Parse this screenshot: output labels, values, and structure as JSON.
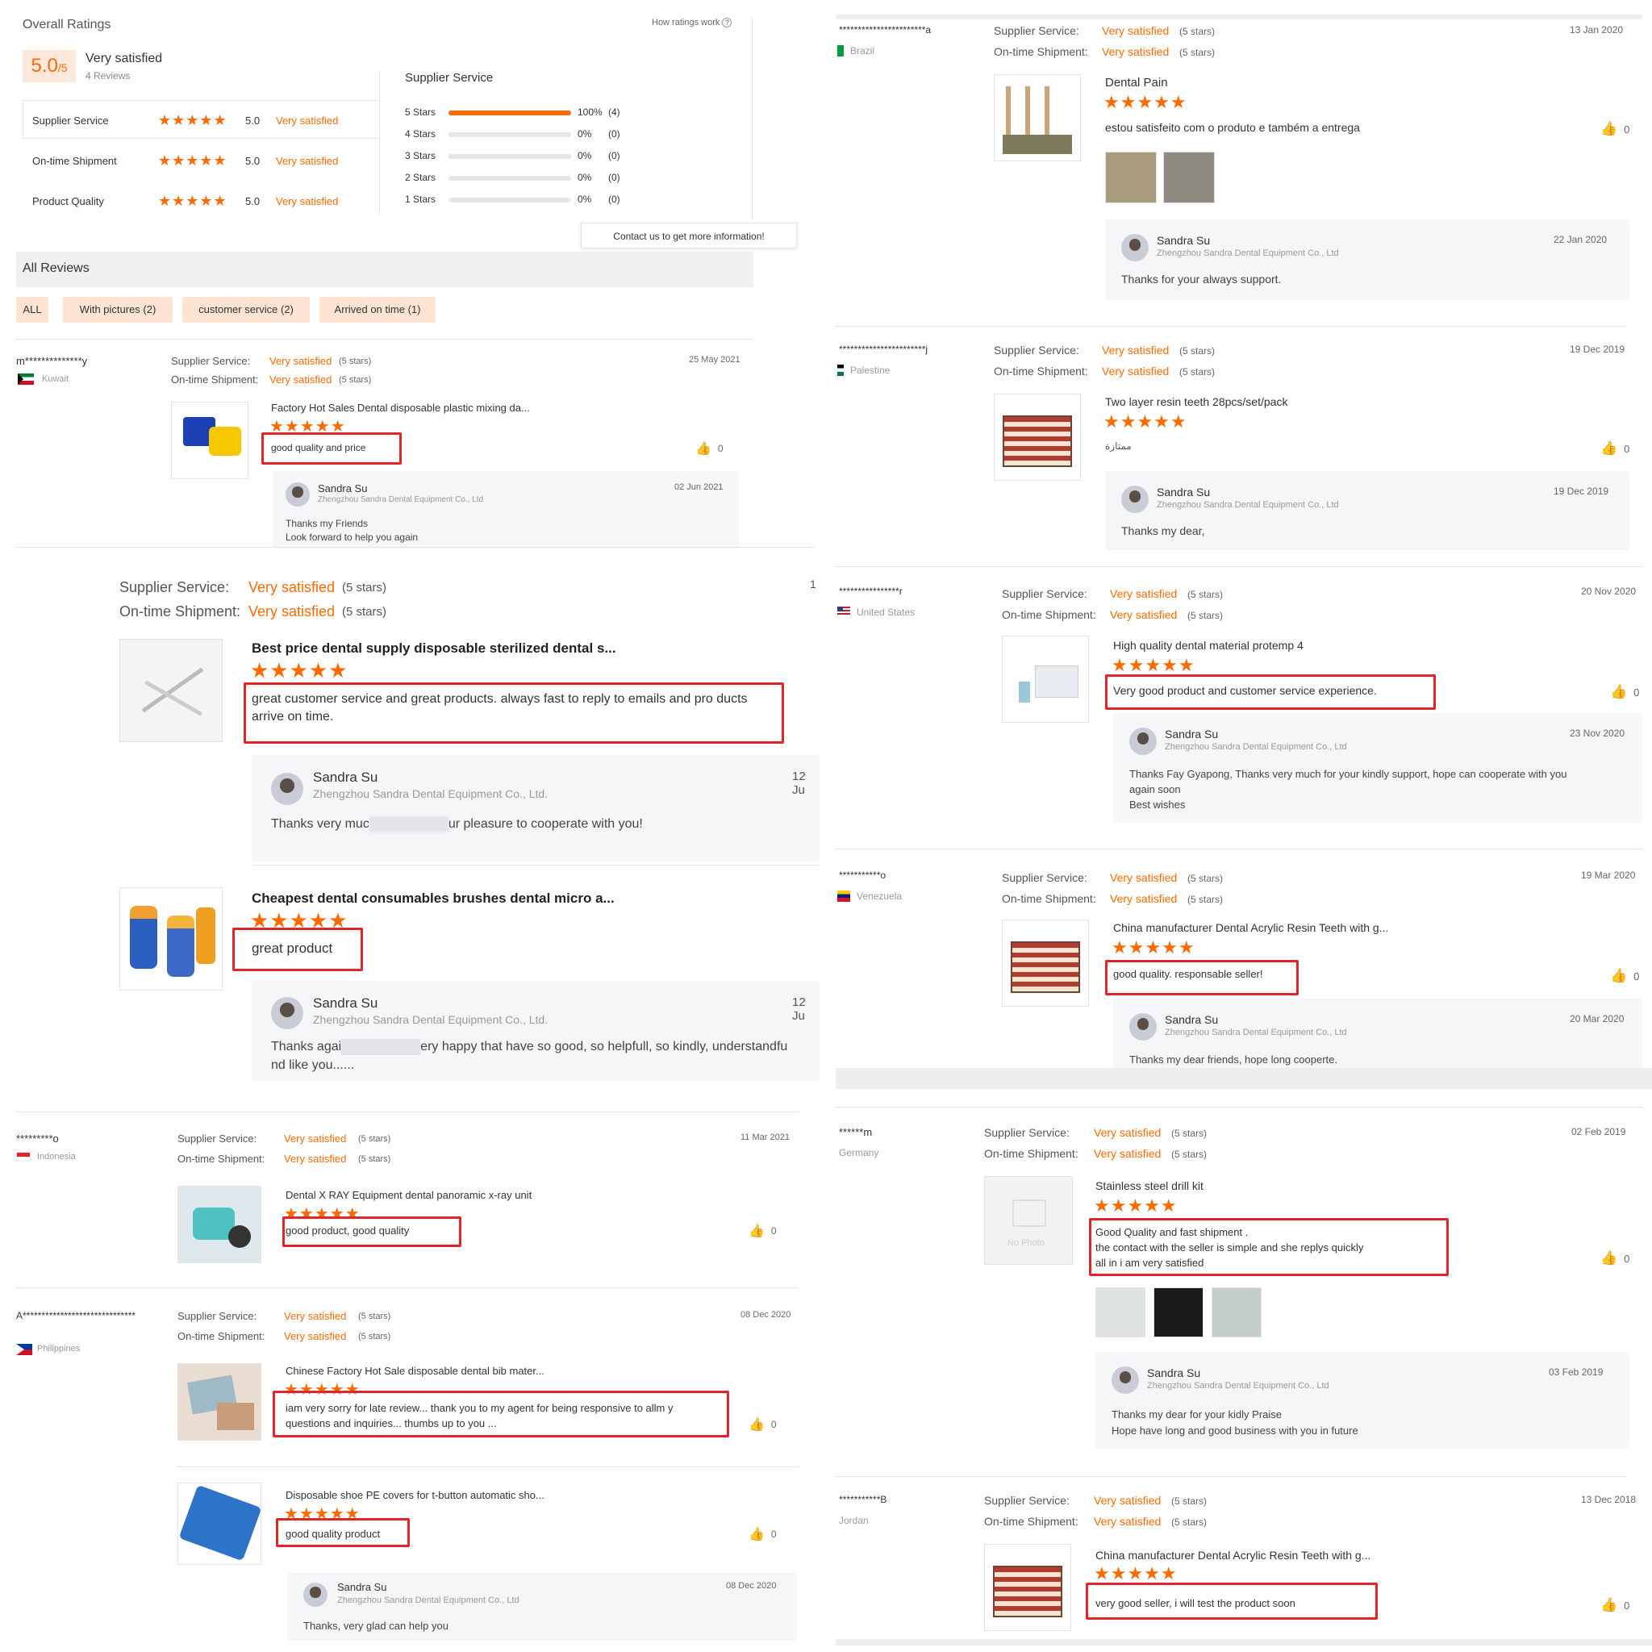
{
  "overall": {
    "title": "Overall Ratings",
    "how_link": "How ratings work",
    "score": "5.0",
    "score_suffix": "/5",
    "satisfaction": "Very satisfied",
    "reviews_count": "4 Reviews",
    "rows": [
      {
        "label": "Supplier Service",
        "stars": "★★★★★",
        "value": "5.0",
        "text": "Very satisfied"
      },
      {
        "label": "On-time Shipment",
        "stars": "★★★★★",
        "value": "5.0",
        "text": "Very satisfied"
      },
      {
        "label": "Product Quality",
        "stars": "★★★★★",
        "value": "5.0",
        "text": "Very satisfied"
      }
    ],
    "breakdown_title": "Supplier Service",
    "breakdown": [
      {
        "label": "5 Stars",
        "percent": "100%",
        "count": "(4)",
        "fill": 1.0
      },
      {
        "label": "4 Stars",
        "percent": "0%",
        "count": "(0)",
        "fill": 0
      },
      {
        "label": "3 Stars",
        "percent": "0%",
        "count": "(0)",
        "fill": 0
      },
      {
        "label": "2 Stars",
        "percent": "0%",
        "count": "(0)",
        "fill": 0
      },
      {
        "label": "1 Stars",
        "percent": "0%",
        "count": "(0)",
        "fill": 0
      }
    ],
    "contact": "Contact us to get more information!"
  },
  "all_reviews": {
    "title": "All Reviews",
    "filters": [
      "ALL",
      "With pictures (2)",
      "customer service (2)",
      "Arrived on time (1)"
    ]
  },
  "labels": {
    "supplier_service": "Supplier Service:",
    "ontime_shipment": "On-time Shipment:",
    "very_satisfied": "Very satisfied",
    "five_stars": "(5 stars)",
    "stars": "★★★★★",
    "likes": "0",
    "seller": "Sandra Su",
    "company": "Zhengzhou Sandra Dental Equipment Co., Ltd.",
    "company_alt": "Zhengzhou Sandra Dental Equipment Co., Ltd",
    "no_photo": "No Photo"
  },
  "left": {
    "r1": {
      "user": "m**************y",
      "country": "Kuwait",
      "date": "25 May 2021",
      "product": "Factory Hot Sales Dental disposable plastic mixing da...",
      "review": "good quality and price",
      "reply_date": "02 Jun 2021",
      "reply": [
        "Thanks my Friends",
        "Look forward to help you again"
      ]
    },
    "big1": {
      "corner": "1",
      "product": "Best price dental supply disposable sterilized dental s...",
      "review": "great customer service and great products. always fast to reply to emails and pro ducts arrive on time.",
      "reply_date": "12 Ju",
      "reply_a": "Thanks very muc",
      "reply_b": "ur pleasure to cooperate with you!"
    },
    "big2": {
      "product": "Cheapest dental consumables brushes dental micro a...",
      "review": "great product",
      "reply_date": "12 Ju",
      "reply_a": "Thanks agai",
      "reply_b": "ery happy that have so good, so helpfull, so kindly, understandfu",
      "reply_c": "nd like you......"
    },
    "r2": {
      "user": "*********o",
      "country": "Indonesia",
      "date": "11 Mar 2021",
      "product": "Dental X RAY Equipment dental panoramic x-ray unit",
      "review": "good product, good quality"
    },
    "r3": {
      "user": "A******************************",
      "country": "Philippines",
      "date": "08 Dec 2020",
      "product": "Chinese Factory Hot Sale disposable dental bib mater...",
      "review": "iam very sorry for late review... thank you to my agent for being responsive to allm y questions and inquiries... thumbs up to you ...",
      "product2": "Disposable shoe PE covers for t-button automatic sho...",
      "review2": "good quality product",
      "reply_date": "08 Dec 2020",
      "reply": "Thanks, very glad can help  you"
    }
  },
  "right": {
    "r1": {
      "user": "***********************a",
      "country": "Brazil",
      "date": "13 Jan 2020",
      "product": "Dental Pain",
      "review": "estou satisfeito com o produto e também a entrega",
      "reply_date": "22 Jan 2020",
      "reply": "Thanks for your always support."
    },
    "r2": {
      "user": "***********************j",
      "country": "Palestine",
      "date": "19 Dec 2019",
      "product": "Two layer resin teeth 28pcs/set/pack",
      "review": "ممتازة",
      "reply_date": "19 Dec 2019",
      "reply": "Thanks my dear,"
    },
    "r3": {
      "user": "****************r",
      "country": "United States",
      "date": "20 Nov 2020",
      "product": "High quality dental material protemp 4",
      "review": "Very good product and customer service experience.",
      "reply_date": "23 Nov 2020",
      "reply": [
        "Thanks Fay Gyapong, Thanks very much for your kindly support, hope can cooperate with you",
        "again soon",
        "Best wishes"
      ]
    },
    "r4": {
      "user": "***********o",
      "country": "Venezuela",
      "date": "19 Mar 2020",
      "product": "China manufacturer Dental Acrylic Resin Teeth with g...",
      "review": "good quality. responsable seller!",
      "reply_date": "20 Mar 2020",
      "reply": "Thanks my dear  friends, hope long cooperte."
    },
    "r5": {
      "user": "******m",
      "country": "Germany",
      "date": "02 Feb 2019",
      "product": "Stainless steel drill kit",
      "review": [
        "Good Quality and fast shipment .",
        "the contact with the seller is simple and she replys quickly",
        "all in i am very satisfied"
      ],
      "reply_date": "03 Feb 2019",
      "reply": [
        "Thanks my dear for your kidly Praise",
        "Hope have long and good business with you in future"
      ]
    },
    "r6": {
      "user": "***********B",
      "country": "Jordan",
      "date": "13 Dec 2018",
      "product": "China manufacturer Dental Acrylic Resin Teeth with g...",
      "review": "very good seller, i will test the product soon"
    }
  },
  "colors": {
    "accent": "#ff6a00",
    "highlight": "#e0262b",
    "filter_bg": "#fde3d2"
  }
}
